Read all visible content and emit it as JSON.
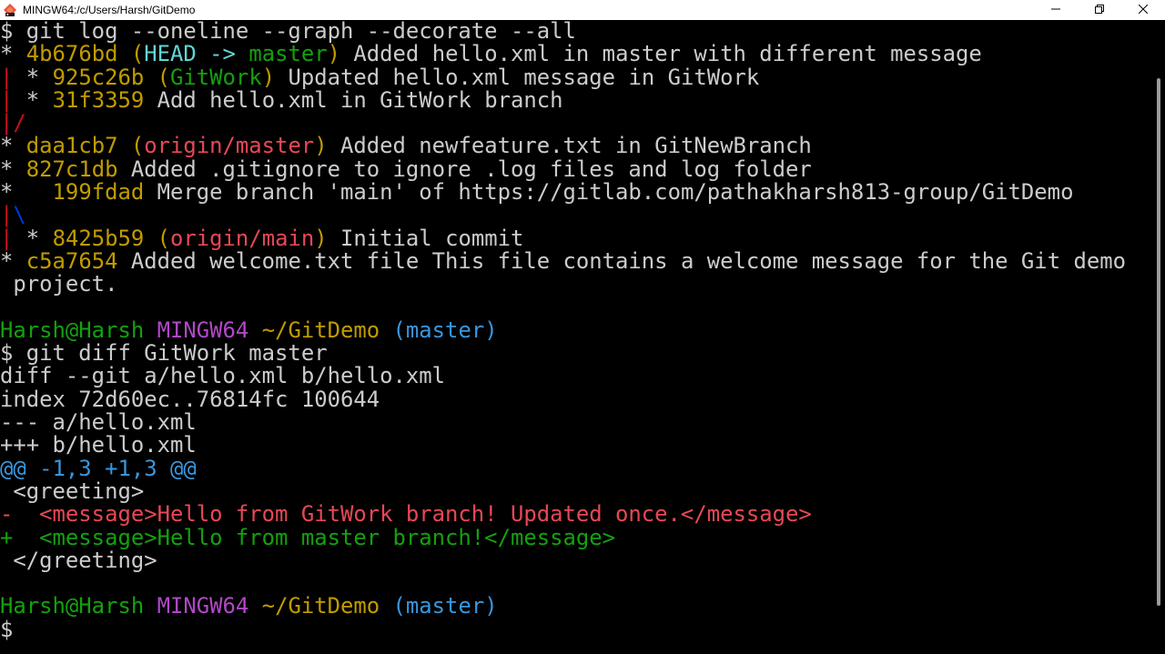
{
  "window": {
    "title": "MINGW64:/c/Users/Harsh/GitDemo",
    "icon": "git-bash-icon",
    "controls": [
      "minimize-icon",
      "restore-icon",
      "close-icon"
    ]
  },
  "colors": {
    "default": "#cccccc",
    "yellow": "#c19c00",
    "red": "#e74856",
    "cyan": "#3a96dd",
    "cyan_bright": "#61d6d6",
    "green": "#13a10e",
    "magenta": "#b148c6",
    "graph_red": "#c50f1f",
    "graph_blue": "#0037da"
  },
  "terminal": {
    "lines": [
      [
        {
          "t": "$ git log --oneline --graph --decorate --all",
          "c": "default"
        }
      ],
      [
        {
          "t": "* ",
          "c": "default"
        },
        {
          "t": "4b676bd (",
          "c": "yellow"
        },
        {
          "t": "HEAD -> ",
          "c": "cyan_bright"
        },
        {
          "t": "master",
          "c": "green"
        },
        {
          "t": ")",
          "c": "yellow"
        },
        {
          "t": " Added hello.xml in master with different message",
          "c": "default"
        }
      ],
      [
        {
          "t": "| ",
          "c": "graph_red"
        },
        {
          "t": "* ",
          "c": "default"
        },
        {
          "t": "925c26b (",
          "c": "yellow"
        },
        {
          "t": "GitWork",
          "c": "green"
        },
        {
          "t": ")",
          "c": "yellow"
        },
        {
          "t": " Updated hello.xml message in GitWork",
          "c": "default"
        }
      ],
      [
        {
          "t": "| ",
          "c": "graph_red"
        },
        {
          "t": "* ",
          "c": "default"
        },
        {
          "t": "31f3359",
          "c": "yellow"
        },
        {
          "t": " Add hello.xml in GitWork branch",
          "c": "default"
        }
      ],
      [
        {
          "t": "|/",
          "c": "graph_red"
        }
      ],
      [
        {
          "t": "* ",
          "c": "default"
        },
        {
          "t": "daa1cb7 (",
          "c": "yellow"
        },
        {
          "t": "origin/master",
          "c": "red"
        },
        {
          "t": ")",
          "c": "yellow"
        },
        {
          "t": " Added newfeature.txt in GitNewBranch",
          "c": "default"
        }
      ],
      [
        {
          "t": "* ",
          "c": "default"
        },
        {
          "t": "827c1db",
          "c": "yellow"
        },
        {
          "t": " Added .gitignore to ignore .log files and log folder",
          "c": "default"
        }
      ],
      [
        {
          "t": "*   ",
          "c": "default"
        },
        {
          "t": "199fdad",
          "c": "yellow"
        },
        {
          "t": " Merge branch 'main' of https://gitlab.com/pathakharsh813-group/GitDemo",
          "c": "default"
        }
      ],
      [
        {
          "t": "|",
          "c": "graph_red"
        },
        {
          "t": "\\",
          "c": "graph_blue"
        }
      ],
      [
        {
          "t": "| ",
          "c": "graph_red"
        },
        {
          "t": "* ",
          "c": "default"
        },
        {
          "t": "8425b59 (",
          "c": "yellow"
        },
        {
          "t": "origin/main",
          "c": "red"
        },
        {
          "t": ")",
          "c": "yellow"
        },
        {
          "t": " Initial commit",
          "c": "default"
        }
      ],
      [
        {
          "t": "* ",
          "c": "default"
        },
        {
          "t": "c5a7654",
          "c": "yellow"
        },
        {
          "t": " Added welcome.txt file This file contains a welcome message for the Git demo",
          "c": "default"
        }
      ],
      [
        {
          "t": " project.",
          "c": "default"
        }
      ],
      [
        {
          "t": "",
          "c": "default"
        }
      ],
      [
        {
          "t": "Harsh@Harsh ",
          "c": "green"
        },
        {
          "t": "MINGW64 ",
          "c": "magenta"
        },
        {
          "t": "~/GitDemo",
          "c": "yellow"
        },
        {
          "t": " (master)",
          "c": "cyan"
        }
      ],
      [
        {
          "t": "$ git diff GitWork master",
          "c": "default"
        }
      ],
      [
        {
          "t": "diff --git a/hello.xml b/hello.xml",
          "c": "default"
        }
      ],
      [
        {
          "t": "index 72d60ec..76814fc 100644",
          "c": "default"
        }
      ],
      [
        {
          "t": "--- a/hello.xml",
          "c": "default"
        }
      ],
      [
        {
          "t": "+++ b/hello.xml",
          "c": "default"
        }
      ],
      [
        {
          "t": "@@ -1,3 +1,3 @@",
          "c": "cyan"
        }
      ],
      [
        {
          "t": " <greeting>",
          "c": "default"
        }
      ],
      [
        {
          "t": "-  <message>Hello from GitWork branch! Updated once.</message>",
          "c": "red"
        }
      ],
      [
        {
          "t": "+  <message>Hello from master branch!</message>",
          "c": "green"
        }
      ],
      [
        {
          "t": " </greeting>",
          "c": "default"
        }
      ],
      [
        {
          "t": "",
          "c": "default"
        }
      ],
      [
        {
          "t": "Harsh@Harsh ",
          "c": "green"
        },
        {
          "t": "MINGW64 ",
          "c": "magenta"
        },
        {
          "t": "~/GitDemo",
          "c": "yellow"
        },
        {
          "t": " (master)",
          "c": "cyan"
        }
      ],
      [
        {
          "t": "$ ",
          "c": "default"
        }
      ]
    ]
  }
}
